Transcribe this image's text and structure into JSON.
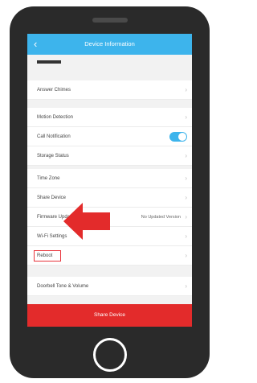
{
  "header": {
    "title": "Device Information",
    "back_icon": "chevron-left-icon"
  },
  "settings": {
    "answer_chimes": "Answer Chimes",
    "motion_detection": "Motion Detection",
    "call_notification": "Call Notification",
    "call_notification_on": true,
    "storage_status": "Storage Status",
    "time_zone": "Time Zone",
    "share_device": "Share Device",
    "firmware_update": "Firmware Update",
    "firmware_update_value": "No Updated Version",
    "wifi_settings": "Wi-Fi Settings",
    "reboot": "Reboot",
    "doorbell_tone": "Doorbell Tone & Volume"
  },
  "actions": {
    "share_device_label": "Share Device"
  },
  "colors": {
    "accent": "#3db4ec",
    "danger": "#e32b2b",
    "arrow": "#e32b2b"
  }
}
